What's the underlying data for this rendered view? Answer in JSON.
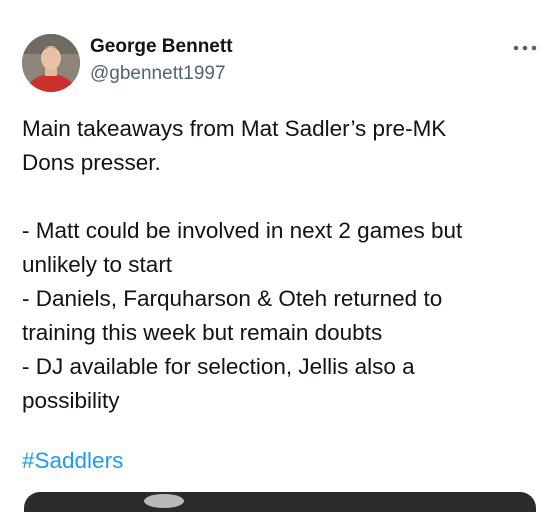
{
  "author": {
    "name": "George Bennett",
    "handle": "@gbennett1997"
  },
  "icons": {
    "more": "more-horizontal-icon",
    "avatar": "profile-photo"
  },
  "tweet": {
    "lines": [
      "Main takeaways from Mat Sadler’s pre-MK",
      "Dons presser.",
      "",
      "- Matt could be involved in next 2 games but",
      "unlikely to start",
      "- Daniels, Farquharson & Oteh returned to",
      "training this week but remain doubts",
      "- DJ available for selection, Jellis also a",
      "possibility"
    ],
    "hashtag": "#Saddlers"
  },
  "colors": {
    "text": "#0f1419",
    "secondary": "#536471",
    "link": "#1d9bf0"
  }
}
